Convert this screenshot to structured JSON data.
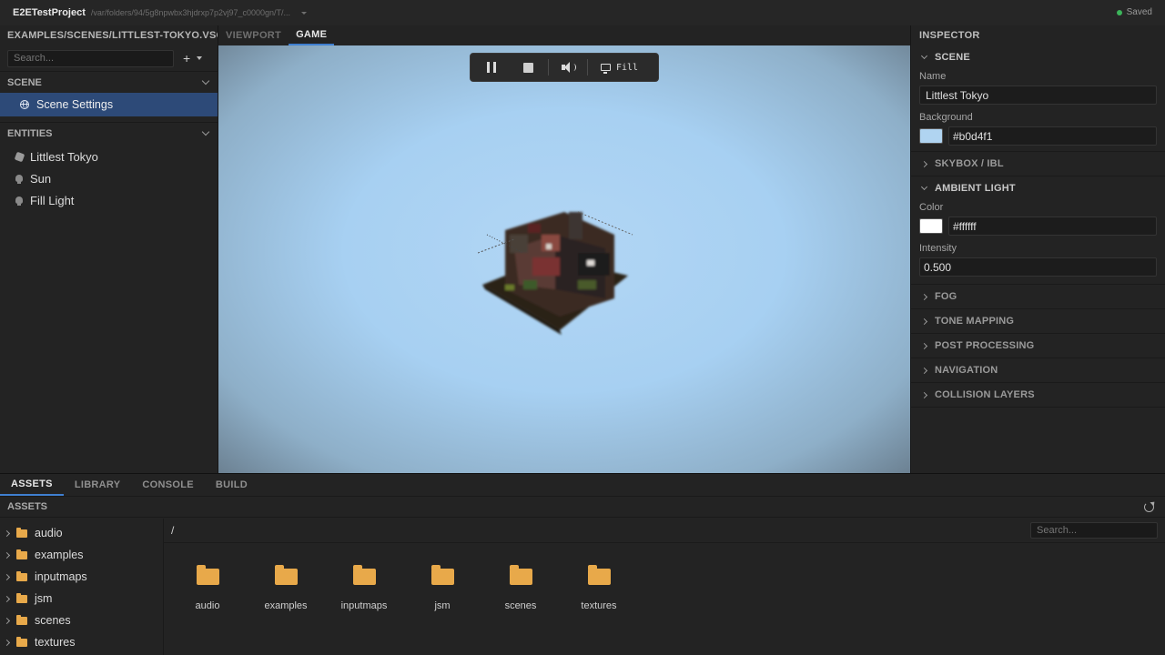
{
  "topbar": {
    "project": "E2ETestProject",
    "path": "/var/folders/94/5g8npwbx3hjdrxp7p2vj97_c0000gn/T/...",
    "status": "Saved"
  },
  "left": {
    "title": "EXAMPLES/SCENES/LITTLEST-TOKYO.VSC",
    "search_placeholder": "Search...",
    "add_label": "+",
    "scene_section": "SCENE",
    "scene_item": "Scene Settings",
    "entities_section": "ENTITIES",
    "entities": [
      "Littlest Tokyo",
      "Sun",
      "Fill Light"
    ]
  },
  "center": {
    "tabs": [
      "VIEWPORT",
      "GAME"
    ],
    "active_tab": "GAME",
    "fill_label": "Fill"
  },
  "inspector": {
    "title": "INSPECTOR",
    "scene_section": "SCENE",
    "name_label": "Name",
    "name_value": "Littlest Tokyo",
    "background_label": "Background",
    "background_value": "#b0d4f1",
    "skybox": "SKYBOX / IBL",
    "ambient_section": "AMBIENT LIGHT",
    "color_label": "Color",
    "color_value": "#ffffff",
    "intensity_label": "Intensity",
    "intensity_value": "0.500",
    "collapsed_sections": [
      "FOG",
      "TONE MAPPING",
      "POST PROCESSING",
      "NAVIGATION",
      "COLLISION LAYERS"
    ]
  },
  "colors": {
    "accent": "#3f7fd0",
    "selection": "#2d4a78",
    "folder": "#e8a94a",
    "background_swatch": "#b0d4f1",
    "ambient_swatch": "#ffffff",
    "saved_dot": "#3cb45a"
  },
  "bottom": {
    "tabs": [
      "ASSETS",
      "LIBRARY",
      "CONSOLE",
      "BUILD"
    ],
    "assets_header": "ASSETS",
    "breadcrumb": "/",
    "search_placeholder": "Search...",
    "tree": [
      "audio",
      "examples",
      "inputmaps",
      "jsm",
      "scenes",
      "textures"
    ],
    "folders": [
      "audio",
      "examples",
      "inputmaps",
      "jsm",
      "scenes",
      "textures"
    ]
  }
}
